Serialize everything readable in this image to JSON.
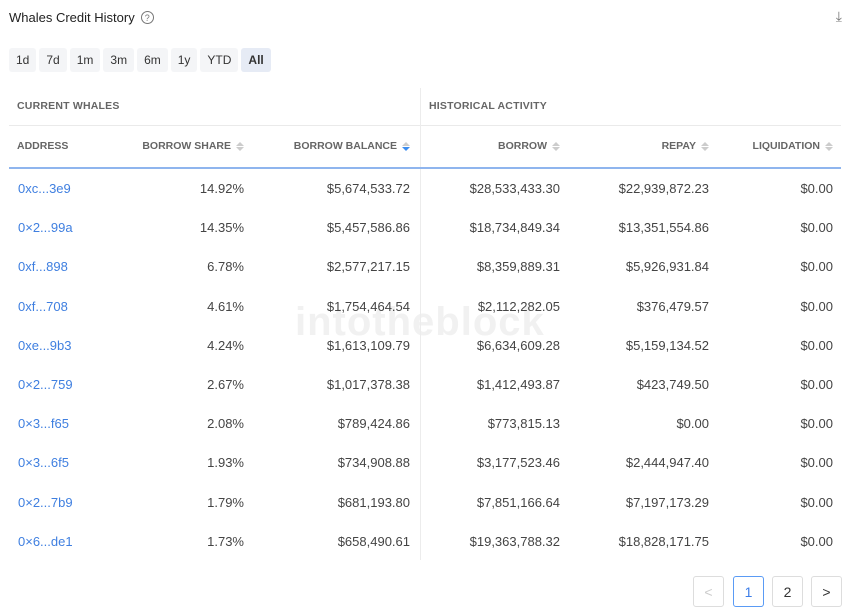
{
  "title": "Whales Credit History",
  "watermark": "intotheblock",
  "ranges": [
    "1d",
    "7d",
    "1m",
    "3m",
    "6m",
    "1y",
    "YTD",
    "All"
  ],
  "active_range": "All",
  "groups": {
    "current": "CURRENT WHALES",
    "historical": "HISTORICAL ACTIVITY"
  },
  "columns": [
    "ADDRESS",
    "BORROW SHARE",
    "BORROW BALANCE",
    "BORROW",
    "REPAY",
    "LIQUIDATION"
  ],
  "rows": [
    [
      "0xc...3e9",
      "14.92%",
      "$5,674,533.72",
      "$28,533,433.30",
      "$22,939,872.23",
      "$0.00"
    ],
    [
      "0×2...99a",
      "14.35%",
      "$5,457,586.86",
      "$18,734,849.34",
      "$13,351,554.86",
      "$0.00"
    ],
    [
      "0xf...898",
      "6.78%",
      "$2,577,217.15",
      "$8,359,889.31",
      "$5,926,931.84",
      "$0.00"
    ],
    [
      "0xf...708",
      "4.61%",
      "$1,754,464.54",
      "$2,112,282.05",
      "$376,479.57",
      "$0.00"
    ],
    [
      "0xe...9b3",
      "4.24%",
      "$1,613,109.79",
      "$6,634,609.28",
      "$5,159,134.52",
      "$0.00"
    ],
    [
      "0×2...759",
      "2.67%",
      "$1,017,378.38",
      "$1,412,493.87",
      "$423,749.50",
      "$0.00"
    ],
    [
      "0×3...f65",
      "2.08%",
      "$789,424.86",
      "$773,815.13",
      "$0.00",
      "$0.00"
    ],
    [
      "0×3...6f5",
      "1.93%",
      "$734,908.88",
      "$3,177,523.46",
      "$2,444,947.40",
      "$0.00"
    ],
    [
      "0×2...7b9",
      "1.79%",
      "$681,193.80",
      "$7,851,166.64",
      "$7,197,173.29",
      "$0.00"
    ],
    [
      "0×6...de1",
      "1.73%",
      "$658,490.61",
      "$19,363,788.32",
      "$18,828,171.75",
      "$0.00"
    ]
  ],
  "pagination": {
    "prev": "<",
    "pages": [
      "1",
      "2"
    ],
    "current": "1",
    "next": ">"
  }
}
